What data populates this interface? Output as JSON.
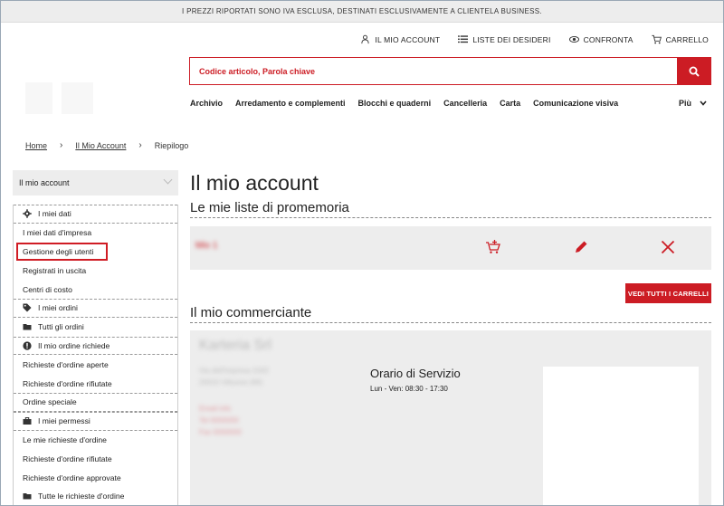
{
  "notice": "I PREZZI RIPORTATI SONO IVA ESCLUSA, DESTINATI ESCLUSIVAMENTE A CLIENTELA BUSINESS.",
  "util_nav": [
    {
      "label": "IL MIO ACCOUNT",
      "icon": "user-icon"
    },
    {
      "label": "LISTE DEI DESIDERI",
      "icon": "list-icon"
    },
    {
      "label": "CONFRONTA",
      "icon": "compare-icon"
    },
    {
      "label": "CARRELLO",
      "icon": "cart-icon"
    }
  ],
  "search": {
    "placeholder": "Codice articolo, Parola chiave",
    "icon": "search-icon"
  },
  "categories": [
    "Archivio",
    "Arredamento e complementi",
    "Blocchi e quaderni",
    "Cancelleria",
    "Carta",
    "Comunicazione visiva"
  ],
  "more_label": "Più",
  "breadcrumb": {
    "home": "Home",
    "account": "Il Mio Account",
    "current": "Riepilogo"
  },
  "sidebar": {
    "header": "Il mio account",
    "items": [
      {
        "label": "I miei dati",
        "section": true,
        "icon": "gear-icon"
      },
      {
        "label": "I miei dati d'impresa",
        "section": false
      },
      {
        "label": "Gestione degli utenti",
        "section": false,
        "highlighted": true
      },
      {
        "label": "Registrati in uscita",
        "section": false
      },
      {
        "label": "Centri di costo",
        "section": false
      },
      {
        "label": "I miei ordini",
        "section": true,
        "icon": "tag-icon"
      },
      {
        "label": "Tutti gli ordini",
        "section": false,
        "icon": "folder-icon"
      },
      {
        "label": "Il mio ordine richiede",
        "section": true,
        "icon": "exclamation-icon"
      },
      {
        "label": "Richieste d'ordine aperte",
        "section": false
      },
      {
        "label": "Richieste d'ordine rifiutate",
        "section": false
      },
      {
        "label": "Ordine speciale",
        "section": true
      },
      {
        "label": "I miei permessi",
        "section": true,
        "icon": "briefcase-icon"
      },
      {
        "label": "Le mie richieste d'ordine",
        "section": false
      },
      {
        "label": "Richieste d'ordine rifiutate",
        "section": false
      },
      {
        "label": "Richieste d'ordine approvate",
        "section": false
      },
      {
        "label": "Tutte le richieste d'ordine",
        "section": false,
        "icon": "folder-icon"
      }
    ]
  },
  "main": {
    "title": "Il mio account",
    "lists_title": "Le mie liste di promemoria",
    "list_name": "Mio 1",
    "view_all_button": "VEDI TUTTI I CARRELLI",
    "dealer_title": "Il mio commerciante",
    "dealer_name": "Karteria Srl",
    "dealer_address": [
      "Via dell'Impresa 1043",
      "20010 Vittuone (MI)"
    ],
    "dealer_contacts": [
      "Email info",
      "Tel 0000000",
      "Fax 0000000"
    ],
    "hours_title": "Orario di Servizio",
    "hours_value": "Lun - Ven: 08:30 - 17:30"
  },
  "colors": {
    "brand_red": "#cc1c24",
    "panel_gray": "#ededed"
  }
}
